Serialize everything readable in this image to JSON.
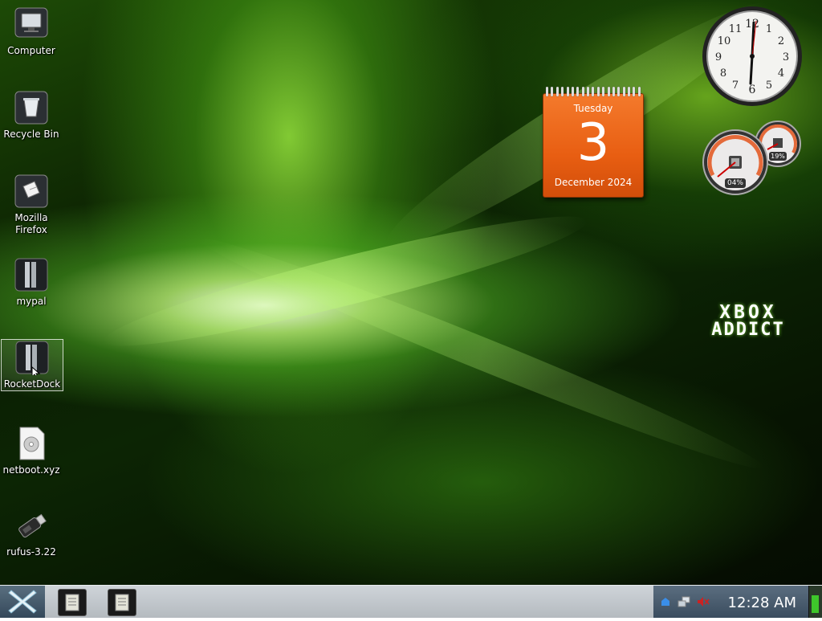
{
  "desktop": {
    "icons": [
      {
        "label": "Computer",
        "icon": "computer-monitor-icon"
      },
      {
        "label": "Recycle Bin",
        "icon": "recycle-bin-icon"
      },
      {
        "label": "Mozilla Firefox",
        "icon": "firefox-icon"
      },
      {
        "label": "mypal",
        "icon": "mypal-app-icon"
      },
      {
        "label": "RocketDock",
        "icon": "rocketdock-app-icon"
      },
      {
        "label": "netboot.xyz",
        "icon": "disc-image-file-icon"
      },
      {
        "label": "rufus-3.22",
        "icon": "usb-drive-icon"
      }
    ],
    "selected_icon": "RocketDock"
  },
  "gadgets": {
    "clock": {
      "hours_shown": "12",
      "numerals": [
        "12",
        "1",
        "2",
        "3",
        "4",
        "5",
        "6",
        "7",
        "8",
        "9",
        "10",
        "11"
      ]
    },
    "calendar": {
      "weekday": "Tuesday",
      "day": "3",
      "month_year": "December 2024",
      "color": "#e8601a"
    },
    "cpu_meter": {
      "cpu_percent": "04%",
      "memory_percent": "19%"
    }
  },
  "wallpaper": {
    "brand_line1": "XBOX",
    "brand_line2": "ADDICT",
    "accent": "#6fd11f"
  },
  "taskbar": {
    "start_icon": "x-logo-start-icon",
    "tasks": [
      {
        "icon": "notepad-icon"
      },
      {
        "icon": "notepad-icon"
      }
    ],
    "tray_icons": [
      "network-icon",
      "computer-network-icon",
      "volume-muted-icon"
    ],
    "clock": "12:28 AM"
  }
}
